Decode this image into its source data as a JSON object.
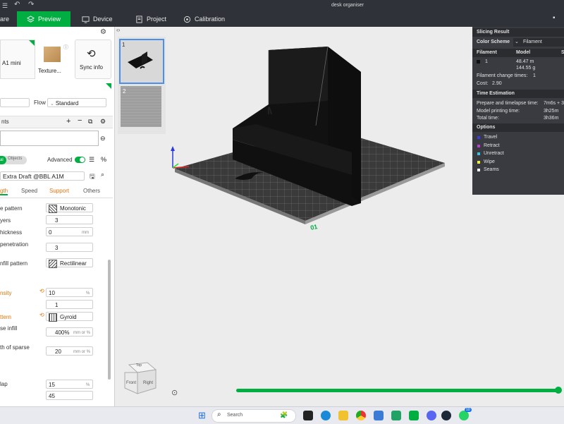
{
  "window": {
    "title": "desk organiser"
  },
  "nav": {
    "prepare": "are",
    "preview": "Preview",
    "device": "Device",
    "project": "Project",
    "calibration": "Calibration"
  },
  "printer": {
    "name": "A1 mini",
    "plate": "Texture...",
    "sync": "Sync info"
  },
  "filament_row": {
    "flow_label": "Flow",
    "flow_value": "Standard"
  },
  "components": {
    "label": "nts"
  },
  "objects": {
    "global_tab": "al",
    "objects_tab": "Objects",
    "advanced_label": "Advanced"
  },
  "profile": {
    "name": "Extra Draft @BBL A1M"
  },
  "setting_tabs": [
    "gth",
    "Speed",
    "Support",
    "Others"
  ],
  "settings": {
    "pattern_label": "e pattern",
    "pattern_value": "Monotonic",
    "layers_label": "yers",
    "layers_value": "3",
    "thickness_label": "hickness",
    "thickness_value": "0",
    "thickness_unit": "mm",
    "penetration_label": "penetration",
    "penetration_value": "3",
    "infill_pattern_label": "nfill pattern",
    "infill_pattern_value": "Rectilinear",
    "density_label": "nsity",
    "density_value": "10",
    "density_unit": "%",
    "extra_value": "1",
    "sparse_pattern_label": "ttern",
    "sparse_pattern_value": "Gyroid",
    "sparse_infill_label": "se infill",
    "sparse_infill_value": "400%",
    "sparse_infill_unit": "mm or %",
    "th_sparse_label": "th of sparse",
    "th_sparse_value": "20",
    "th_sparse_unit": "mm or %",
    "overlap_label": "lap",
    "overlap_value": "15",
    "overlap_unit": "%",
    "angle_value": "45"
  },
  "plates": [
    {
      "number": "1"
    },
    {
      "number": "2"
    }
  ],
  "plate_label": "01",
  "view_cube": {
    "front": "Front",
    "right": "Right",
    "top": "Top"
  },
  "slicing": {
    "title": "Slicing Result",
    "color_scheme_label": "Color Scheme",
    "color_scheme_value": "Filament",
    "col_filament": "Filament",
    "col_model": "Model",
    "col_s": "S",
    "filament_id": "1",
    "model_length": "48.47 m",
    "model_weight": "144.55 g",
    "change_times_label": "Filament change times:",
    "change_times_value": "1",
    "cost_label": "Cost:",
    "cost_value": "2.90",
    "time_title": "Time Estimation",
    "prepare_label": "Prepare and timelapse time:",
    "prepare_value": "7m6s + 3",
    "model_time_label": "Model printing time:",
    "model_time_value": "3h25m",
    "total_label": "Total time:",
    "total_value": "3h36m",
    "options_title": "Options",
    "options": [
      {
        "label": "Travel",
        "color": "#3a3af0"
      },
      {
        "label": "Retract",
        "color": "#c03ad6"
      },
      {
        "label": "Unretract",
        "color": "#3ac0e0"
      },
      {
        "label": "Wipe",
        "color": "#f0f03a"
      },
      {
        "label": "Seams",
        "color": "#f0f0f0"
      }
    ]
  },
  "progress": {
    "value": 1.0,
    "color": "#00ae42"
  },
  "taskbar": {
    "search_placeholder": "Search",
    "badge": "10"
  },
  "colors": {
    "accent": "#00ae42",
    "orange": "#e8730c",
    "dark": "#2f3239"
  }
}
